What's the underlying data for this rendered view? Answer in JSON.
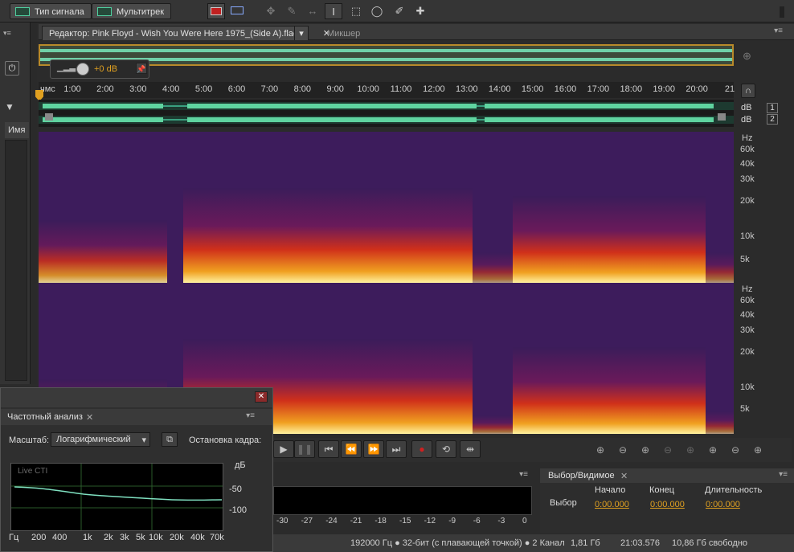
{
  "toolbar": {
    "waveform_label": "Тип сигнала",
    "multitrack_label": "Мультитрек"
  },
  "editor": {
    "tab_label": "Редактор: Pink Floyd - Wish You Were Here 1975_(Side A).flac",
    "mixer_label": "Микшер",
    "gain_value": "+0 dB"
  },
  "left": {
    "name_label": "Имя"
  },
  "ruler": {
    "unit": "чмс",
    "ticks": [
      "1:00",
      "2:00",
      "3:00",
      "4:00",
      "5:00",
      "6:00",
      "7:00",
      "8:00",
      "9:00",
      "10:00",
      "11:00",
      "12:00",
      "13:00",
      "14:00",
      "15:00",
      "16:00",
      "17:00",
      "18:00",
      "19:00",
      "20:00",
      "21"
    ]
  },
  "channels": {
    "db_label": "dB",
    "ch1": "1",
    "ch2": "2"
  },
  "spectrum_axis": {
    "unit": "Hz",
    "labels": [
      "60k",
      "40k",
      "30k",
      "20k",
      "10k",
      "5k"
    ]
  },
  "freq_panel": {
    "title": "Частотный анализ",
    "scale_label": "Масштаб:",
    "scale_value": "Логарифмический",
    "freeze_label": "Остановка кадра:",
    "live_label": "Live CTI",
    "db_unit": "дБ",
    "y_labels": [
      "-50",
      "-100"
    ],
    "x_labels": [
      "Гц",
      "200",
      "400",
      "1k",
      "2k",
      "3k",
      "5k",
      "10k",
      "20k",
      "40k",
      "70k"
    ]
  },
  "meter": {
    "scale": [
      "-30",
      "-27",
      "-24",
      "-21",
      "-18",
      "-15",
      "-12",
      "-9",
      "-6",
      "-3",
      "0"
    ]
  },
  "selection": {
    "title": "Выбор/Видимое",
    "col_start": "Начало",
    "col_end": "Конец",
    "col_duration": "Длительность",
    "row_label": "Выбор",
    "start": "0:00.000",
    "end": "0:00.000",
    "duration": "0:00.000"
  },
  "status": {
    "format": "192000 Гц ● 32-бит (с плавающей точкой) ● 2 Канал",
    "size": "1,81 Гб",
    "duration": "21:03.576",
    "free": "10,86 Гб свободно"
  }
}
